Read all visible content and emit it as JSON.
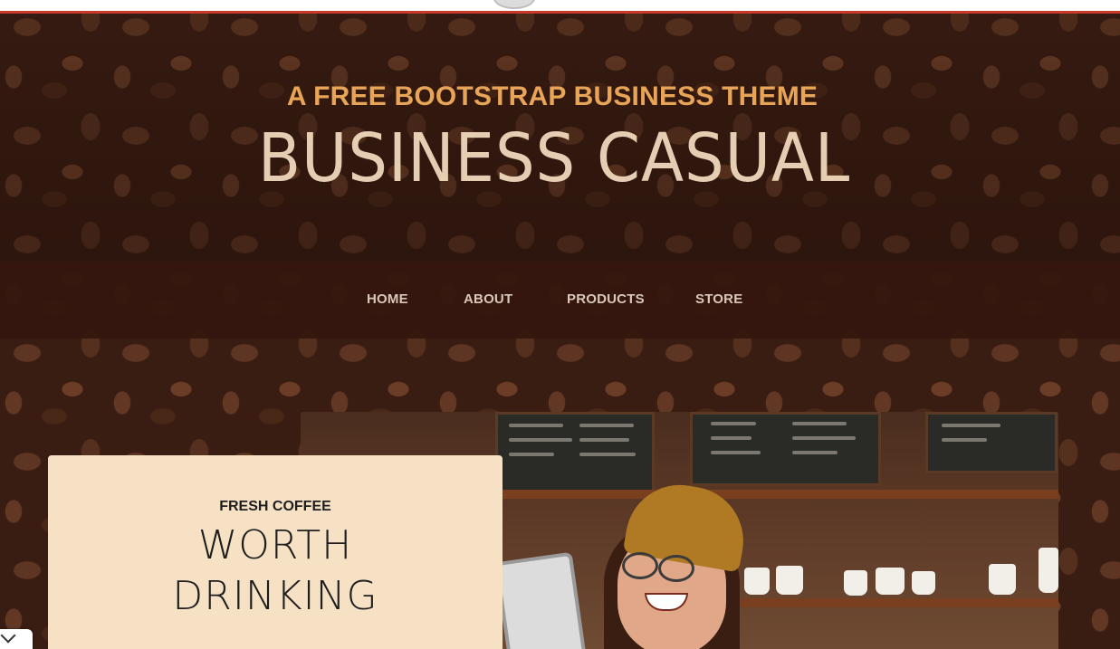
{
  "header": {
    "subtitle": "A FREE BOOTSTRAP BUSINESS THEME",
    "title": "BUSINESS CASUAL"
  },
  "nav": {
    "items": [
      {
        "label": "HOME"
      },
      {
        "label": "ABOUT"
      },
      {
        "label": "PRODUCTS"
      },
      {
        "label": "STORE"
      }
    ]
  },
  "intro": {
    "kicker": "FRESH COFFEE",
    "heading_line1": "WORTH",
    "heading_line2": "DRINKING"
  },
  "colors": {
    "accent": "#e8a457",
    "title": "#f5dec0",
    "navbar": "#34160e",
    "card": "#f6e1c5",
    "top_border": "#c83a2a"
  },
  "icons": {
    "corner_toggle": "chevron-down-icon"
  }
}
